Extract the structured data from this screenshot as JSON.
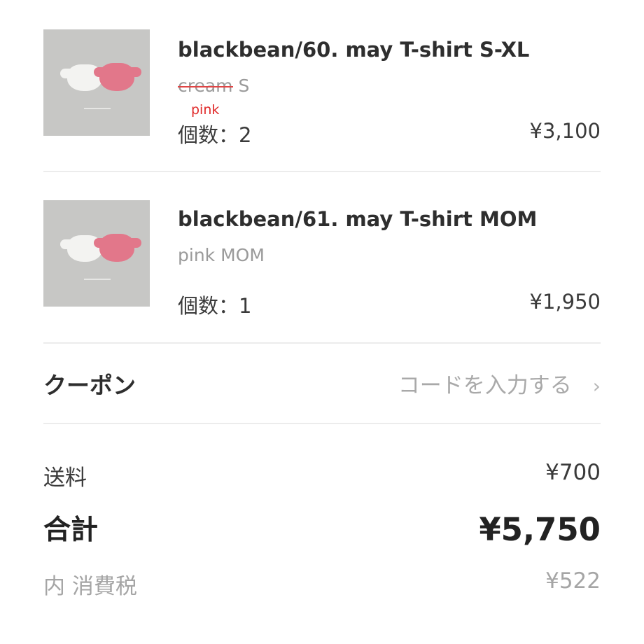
{
  "cart_items": [
    {
      "title": "blackbean/60. may T-shirt S-XL",
      "variant_struck": "cream",
      "variant_rest": " S",
      "handwritten_note": "pink",
      "quantity": "個数：2",
      "price": "¥3,100",
      "image_icon": "tshirt-product-photo"
    },
    {
      "title": "blackbean/61. may T-shirt MOM",
      "variant": "pink MOM",
      "quantity": "個数：1",
      "price": "¥1,950",
      "image_icon": "tshirt-product-photo"
    }
  ],
  "coupon": {
    "label": "クーポン",
    "action": "コードを入力する",
    "chevron": "›"
  },
  "summary": {
    "shipping_label": "送料",
    "shipping_value": "¥700",
    "total_label": "合計",
    "total_value": "¥5,750",
    "tax_label": "内 消費税",
    "tax_value": "¥522"
  },
  "colors": {
    "annotation_red": "#e02a2a",
    "muted_text": "#9a9a9a",
    "divider": "#ececec"
  }
}
